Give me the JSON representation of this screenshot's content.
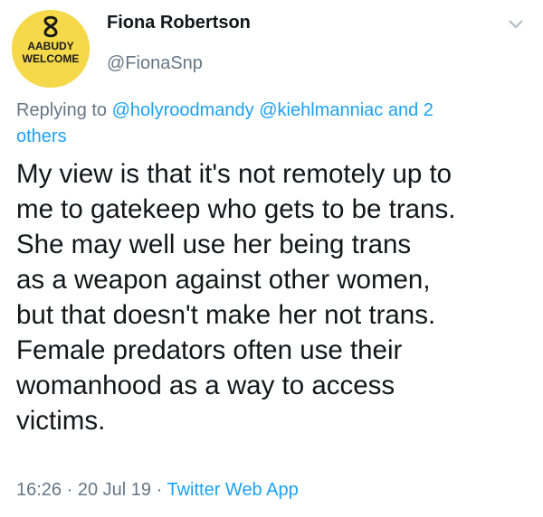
{
  "author": {
    "name": "Fiona Robertson",
    "handle": "@FionaSnp",
    "avatar_badge_lines": [
      "AABUDY",
      "WELCOME"
    ]
  },
  "reply": {
    "prefix": "Replying to",
    "mention_1": "@holyroodmandy",
    "mention_2": "@kiehlmanniac",
    "conjunction": "and",
    "others_count": "2",
    "others_label": "others"
  },
  "tweet": {
    "lines": [
      "My view is that it's not remotely up to",
      "me to gatekeep who gets to be trans.",
      "She may well use her being trans",
      "as a weapon against other women,",
      "but that doesn't make her not trans.",
      "Female predators often use their",
      "womanhood as a way to access",
      "victims."
    ]
  },
  "meta": {
    "time": "16:26",
    "separator": "·",
    "date": "20 Jul 19",
    "app": "Twitter Web App"
  },
  "colors": {
    "text": "#14171a",
    "secondary": "#657786",
    "link": "#1da1f2",
    "avatar_bg": "#f5d94a"
  }
}
